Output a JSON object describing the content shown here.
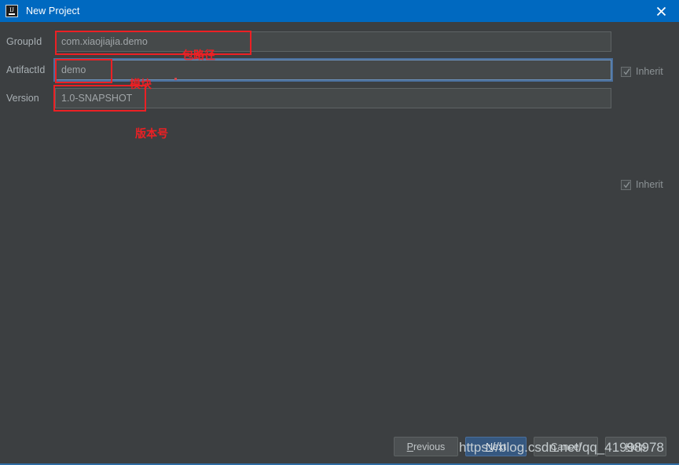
{
  "window": {
    "title": "New Project",
    "icon": "intellij-idea-icon",
    "close_icon": "close-icon",
    "titlebar_color": "#0069c0",
    "background_color": "#3c3f41"
  },
  "form": {
    "fields": [
      {
        "label": "GroupId",
        "value": "com.xiaojiajia.demo",
        "focused": false,
        "inherit": {
          "label": "Inherit",
          "checked": true,
          "visible": true
        }
      },
      {
        "label": "ArtifactId",
        "value": "demo",
        "focused": true,
        "inherit": {
          "label": "",
          "checked": false,
          "visible": false
        }
      },
      {
        "label": "Version",
        "value": "1.0-SNAPSHOT",
        "focused": false,
        "inherit": {
          "label": "Inherit",
          "checked": true,
          "visible": true
        }
      }
    ]
  },
  "annotations": {
    "color": "#ec2024",
    "items": [
      {
        "text": "包路径",
        "meaning": "package-path"
      },
      {
        "text": "模块",
        "meaning": "module"
      },
      {
        "text": "版本号",
        "meaning": "version-number"
      }
    ]
  },
  "buttons": {
    "previous": {
      "label": "Previous",
      "mnemonic": "P",
      "primary": false
    },
    "next": {
      "label": "Next",
      "mnemonic": "N",
      "primary": true
    },
    "cancel": {
      "label": "Cancel",
      "mnemonic": "C",
      "primary": false
    },
    "help": {
      "label": "Help",
      "mnemonic": "H",
      "primary": false
    }
  },
  "watermark": {
    "text": "https://blog.csdn.net/qq_41998978"
  }
}
